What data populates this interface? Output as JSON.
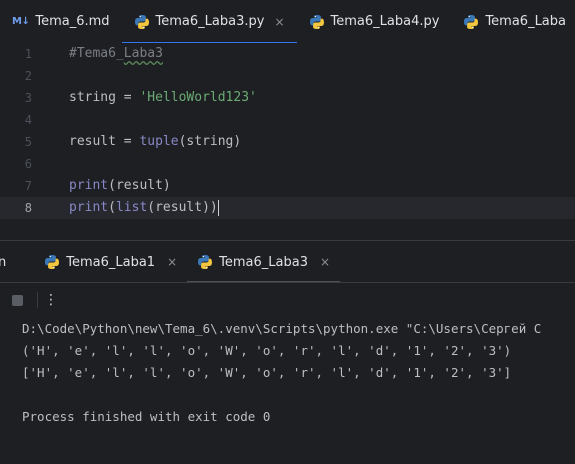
{
  "editor_tabs": [
    {
      "label": "Tema_6.md",
      "icon": "markdown-icon",
      "icon_text": "M↓",
      "active": false,
      "closable": false
    },
    {
      "label": "Tema6_Laba3.py",
      "icon": "python-file-icon",
      "active": true,
      "closable": true
    },
    {
      "label": "Tema6_Laba4.py",
      "icon": "python-file-icon",
      "active": false,
      "closable": false
    },
    {
      "label": "Tema6_Laba",
      "icon": "python-file-icon",
      "active": false,
      "closable": false
    }
  ],
  "close_glyph": "×",
  "code": {
    "line_numbers": [
      "1",
      "2",
      "3",
      "4",
      "5",
      "6",
      "7",
      "8"
    ],
    "line1": "#Tema6_Laba3",
    "line3_var": "string = ",
    "line3_str": "'HelloWorld123'",
    "line5_a": "result = ",
    "line5_fn": "tuple",
    "line5_b": "(string)",
    "line7_fn": "print",
    "line7_b": "(result)",
    "line8_fn": "print",
    "line8_a": "(",
    "line8_fn2": "list",
    "line8_b": "(result))",
    "current_line": "8"
  },
  "run_panel": {
    "cut_label": "n",
    "tabs": [
      {
        "label": "Tema6_Laba1",
        "active": false
      },
      {
        "label": "Tema6_Laba3",
        "active": true
      }
    ],
    "more_glyph": "⋮"
  },
  "console": {
    "lines": [
      "D:\\Code\\Python\\new\\Tema_6\\.venv\\Scripts\\python.exe \"C:\\Users\\Сергей С",
      "('H', 'e', 'l', 'l', 'o', 'W', 'o', 'r', 'l', 'd', '1', '2', '3')",
      "['H', 'e', 'l', 'l', 'o', 'W', 'o', 'r', 'l', 'd', '1', '2', '3']",
      "",
      "Process finished with exit code 0"
    ]
  },
  "colors": {
    "background": "#1e1f22",
    "accent": "#3574f0",
    "string": "#6aab73",
    "builtin": "#8888c6",
    "comment": "#7a7e85"
  }
}
